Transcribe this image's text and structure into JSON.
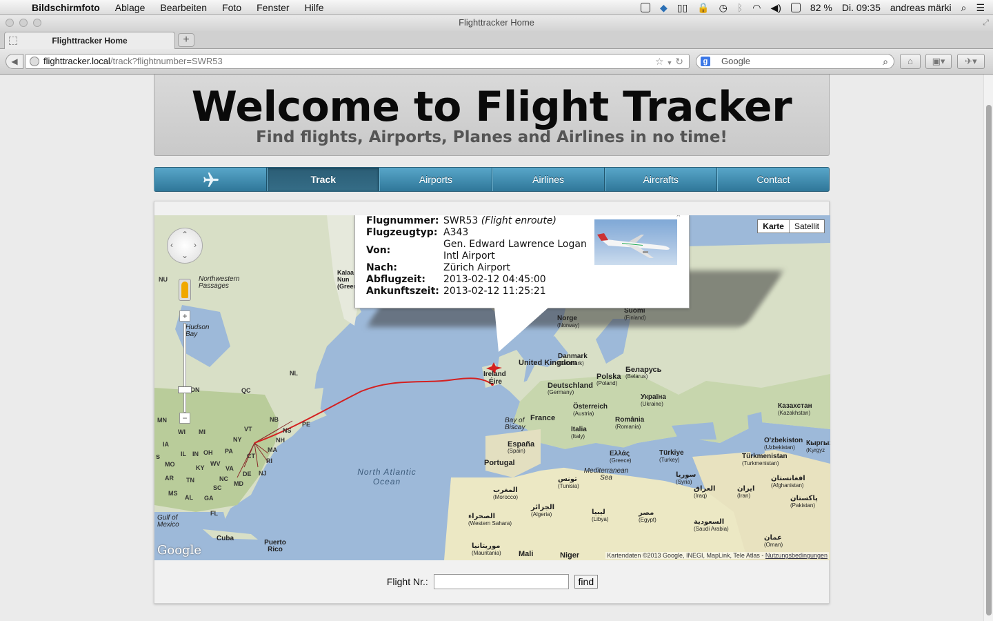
{
  "menubar": {
    "app": "Bildschirmfoto",
    "items": [
      "Ablage",
      "Bearbeiten",
      "Foto",
      "Fenster",
      "Hilfe"
    ],
    "battery": "82 %",
    "clock": "Di. 09:35",
    "user": "andreas märki"
  },
  "window": {
    "title": "Flighttracker Home"
  },
  "tab": {
    "label": "Flighttracker Home"
  },
  "addressbar": {
    "host": "flighttracker.local",
    "path": "/track?flightnumber=SWR53"
  },
  "searchbar": {
    "placeholder": "Google"
  },
  "header": {
    "title": "Welcome to Flight Tracker",
    "subtitle": "Find flights, Airports, Planes and Airlines in no time!"
  },
  "nav": {
    "items": [
      "Track",
      "Airports",
      "Airlines",
      "Aircrafts",
      "Contact"
    ],
    "active": "Track"
  },
  "map": {
    "type_buttons": [
      "Karte",
      "Satellit"
    ],
    "active_type": "Karte",
    "attribution": "Kartendaten ©2013 Google, INEGI, MapLink, Tele Atlas -",
    "terms": "Nutzungsbedingungen",
    "logo": "Google",
    "ocean": "North Atlantic Ocean",
    "route_color": "#d42020",
    "labels": {
      "uk": "United Kingdom",
      "ireland": "Ireland",
      "eire": "Éire",
      "france": "France",
      "spain": "España",
      "spain_sub": "(Spain)",
      "portugal": "Portugal",
      "germany": "Deutschland",
      "germany_sub": "(Germany)",
      "poland": "Polska",
      "poland_sub": "(Poland)",
      "belarus": "Беларусь",
      "belarus_sub": "(Belarus)",
      "ukraine": "Україна",
      "ukraine_sub": "(Ukraine)",
      "italy": "Italia",
      "italy_sub": "(Italy)",
      "norway": "Norge",
      "norway_sub": "(Norway)",
      "finland": "Suomi",
      "finland_sub": "(Finland)",
      "denmark": "Danmark",
      "denmark_sub": "(Denmark)",
      "austria": "Österreich",
      "austria_sub": "(Austria)",
      "romania": "România",
      "romania_sub": "(Romania)",
      "greece": "Ελλάς",
      "greece_sub": "(Greece)",
      "turkey": "Türkiye",
      "turkey_sub": "(Turkey)",
      "kazakhstan": "Казахстан",
      "kazakhstan_sub": "(Kazakhstan)",
      "uzbekistan": "O'zbekiston",
      "uzbekistan_sub": "(Uzbekistan)",
      "kyrgyz": "Кыргыз",
      "kyrgyz_sub": "(Kyrgyz",
      "turkmenistan": "Türkmenistan",
      "turkmenistan_sub": "(Turkmenistan)",
      "afghanistan": "افغانستان",
      "afghanistan_sub": "(Afghanistan)",
      "pakistan": "پاکستان",
      "pakistan_sub": "(Pakistan)",
      "iran": "ایران",
      "iran_sub": "(Iran)",
      "iraq": "العراق",
      "iraq_sub": "(Iraq)",
      "syria": "سوريا",
      "syria_sub": "(Syria)",
      "saudi": "السعودية",
      "saudi_sub": "(Saudi Arabia)",
      "oman": "عمان",
      "oman_sub": "(Oman)",
      "egypt": "مصر",
      "egypt_sub": "(Egypt)",
      "libya": "ليبيا",
      "libya_sub": "(Libya)",
      "tunisia": "تونس",
      "tunisia_sub": "(Tunisia)",
      "algeria": "الجزائر",
      "algeria_sub": "(Algeria)",
      "morocco": "المغرب",
      "morocco_sub": "(Morocco)",
      "wsahara": "الصحراء",
      "wsahara_sub": "(Western Sahara)",
      "mauritania": "موريتانيا",
      "mauritania_sub": "(Mauritania)",
      "mali": "Mali",
      "niger": "Niger",
      "mediterranean": "Mediterranean Sea",
      "biscay": "Bay of Biscay",
      "hudson": "Hudson Bay",
      "nw_passages": "Northwestern Passages",
      "gulf": "Gulf of Mexico",
      "cuba": "Cuba",
      "puerto_rico": "Puerto Rico",
      "greenland": "Kalaa Nun (Green",
      "nu": "NU",
      "nl": "NL",
      "qc": "QC",
      "on": "ON",
      "mn": "MN",
      "wi": "WI",
      "ia": "IA",
      "mo": "MO",
      "ar": "AR",
      "ms": "MS",
      "al": "AL",
      "tn": "TN",
      "ky": "KY",
      "in": "IN",
      "il": "IL",
      "oh": "OH",
      "wv": "WV",
      "va": "VA",
      "nc": "NC",
      "sc": "SC",
      "ga": "GA",
      "fl": "FL",
      "pa": "PA",
      "ny": "NY",
      "vt": "VT",
      "nh": "NH",
      "ma": "MA",
      "ct": "CT",
      "ri": "RI",
      "nj": "NJ",
      "de": "DE",
      "md": "MD",
      "nb": "NB",
      "ns": "NS",
      "pe": "PE",
      "mi": "MI",
      "s": "s"
    }
  },
  "flight": {
    "labels": {
      "number": "Flugnummer:",
      "type": "Flugzeugtyp:",
      "from": "Von:",
      "to": "Nach:",
      "departure": "Abflugzeit:",
      "arrival": "Ankunftszeit:"
    },
    "number": "SWR53",
    "status": "(Flight enroute)",
    "aircraft_type": "A343",
    "from": "Gen. Edward Lawrence Logan Intl Airport",
    "to": "Zürich Airport",
    "departure": "2013-02-12 04:45:00",
    "arrival": "2013-02-12 11:25:21"
  },
  "search_form": {
    "label": "Flight Nr.:",
    "value": "",
    "button": "find"
  }
}
